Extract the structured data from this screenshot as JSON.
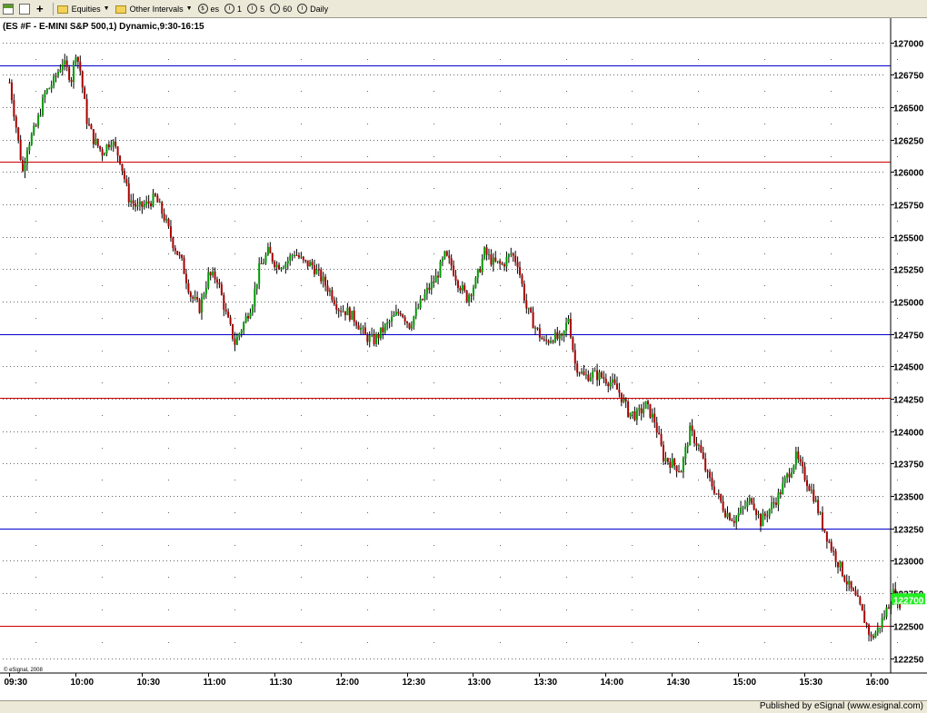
{
  "toolbar": {
    "equities_label": "Equities",
    "other_intervals_label": "Other Intervals",
    "symbol_label": "es",
    "interval_1": "1",
    "interval_5": "5",
    "interval_60": "60",
    "interval_daily": "Daily"
  },
  "footer": {
    "published_label": "Published by eSignal (www.esignal.com)"
  },
  "chart_data": {
    "type": "candlestick",
    "title": "(ES #F - E-MINI S&P 500,1) Dynamic,9:30-16:15",
    "watermark": "© eSignal, 2008",
    "price_label": "122700",
    "price_label_value": 1227.0,
    "y_ticks": [
      {
        "value": 1270.0,
        "label": "127000"
      },
      {
        "value": 1267.5,
        "label": "126750"
      },
      {
        "value": 1265.0,
        "label": "126500"
      },
      {
        "value": 1262.5,
        "label": "126250"
      },
      {
        "value": 1260.0,
        "label": "126000"
      },
      {
        "value": 1257.5,
        "label": "125750"
      },
      {
        "value": 1255.0,
        "label": "125500"
      },
      {
        "value": 1252.5,
        "label": "125250"
      },
      {
        "value": 1250.0,
        "label": "125000"
      },
      {
        "value": 1247.5,
        "label": "124750"
      },
      {
        "value": 1245.0,
        "label": "124500"
      },
      {
        "value": 1242.5,
        "label": "124250"
      },
      {
        "value": 1240.0,
        "label": "124000"
      },
      {
        "value": 1237.5,
        "label": "123750"
      },
      {
        "value": 1235.0,
        "label": "123500"
      },
      {
        "value": 1232.5,
        "label": "123250"
      },
      {
        "value": 1230.0,
        "label": "123000"
      },
      {
        "value": 1227.5,
        "label": "122750"
      },
      {
        "value": 1225.0,
        "label": "122500"
      },
      {
        "value": 1222.5,
        "label": "122250"
      }
    ],
    "x_ticks": [
      {
        "minute": 0,
        "label": "09:30"
      },
      {
        "minute": 30,
        "label": "10:00"
      },
      {
        "minute": 60,
        "label": "10:30"
      },
      {
        "minute": 90,
        "label": "11:00"
      },
      {
        "minute": 120,
        "label": "11:30"
      },
      {
        "minute": 150,
        "label": "12:00"
      },
      {
        "minute": 180,
        "label": "12:30"
      },
      {
        "minute": 210,
        "label": "13:00"
      },
      {
        "minute": 240,
        "label": "13:30"
      },
      {
        "minute": 270,
        "label": "14:00"
      },
      {
        "minute": 300,
        "label": "14:30"
      },
      {
        "minute": 330,
        "label": "15:00"
      },
      {
        "minute": 360,
        "label": "15:30"
      },
      {
        "minute": 390,
        "label": "16:00"
      }
    ],
    "xlim": [
      0,
      405
    ],
    "ylim": [
      1221.5,
      1271.0
    ],
    "horizontal_lines": [
      {
        "value": 1268.2,
        "color": "#0000cc"
      },
      {
        "value": 1260.8,
        "color": "#cc0000"
      },
      {
        "value": 1247.5,
        "color": "#0000cc"
      },
      {
        "value": 1242.6,
        "color": "#cc0000"
      },
      {
        "value": 1232.5,
        "color": "#0000cc"
      },
      {
        "value": 1225.0,
        "color": "#cc0000"
      }
    ],
    "colors": {
      "up": "#009900",
      "down": "#aa0000",
      "wick": "#000000",
      "grid": "#555555",
      "price_label_bg": "#22ee22"
    },
    "price_path": [
      [
        0,
        1266.9
      ],
      [
        3,
        1263.5
      ],
      [
        6,
        1260.0
      ],
      [
        8,
        1262.0
      ],
      [
        12,
        1263.5
      ],
      [
        16,
        1266.0
      ],
      [
        20,
        1267.0
      ],
      [
        24,
        1268.5
      ],
      [
        28,
        1267.2
      ],
      [
        30,
        1269.3
      ],
      [
        32,
        1267.8
      ],
      [
        35,
        1264.0
      ],
      [
        38,
        1262.5
      ],
      [
        42,
        1261.5
      ],
      [
        46,
        1262.5
      ],
      [
        50,
        1261.0
      ],
      [
        54,
        1258.0
      ],
      [
        58,
        1257.2
      ],
      [
        62,
        1257.5
      ],
      [
        66,
        1258.0
      ],
      [
        70,
        1256.5
      ],
      [
        74,
        1254.5
      ],
      [
        78,
        1253.0
      ],
      [
        82,
        1250.5
      ],
      [
        86,
        1249.5
      ],
      [
        90,
        1252.0
      ],
      [
        94,
        1251.8
      ],
      [
        98,
        1249.0
      ],
      [
        102,
        1246.8
      ],
      [
        106,
        1248.3
      ],
      [
        110,
        1250.0
      ],
      [
        113,
        1252.5
      ],
      [
        117,
        1253.8
      ],
      [
        121,
        1252.8
      ],
      [
        125,
        1253.0
      ],
      [
        129,
        1253.8
      ],
      [
        133,
        1253.0
      ],
      [
        137,
        1252.8
      ],
      [
        141,
        1251.8
      ],
      [
        145,
        1250.8
      ],
      [
        149,
        1249.5
      ],
      [
        153,
        1249.2
      ],
      [
        157,
        1248.5
      ],
      [
        161,
        1247.3
      ],
      [
        165,
        1247.0
      ],
      [
        169,
        1247.8
      ],
      [
        173,
        1248.6
      ],
      [
        177,
        1249.3
      ],
      [
        181,
        1248.2
      ],
      [
        185,
        1249.5
      ],
      [
        189,
        1250.8
      ],
      [
        193,
        1251.8
      ],
      [
        197,
        1253.5
      ],
      [
        200,
        1252.8
      ],
      [
        203,
        1251.5
      ],
      [
        207,
        1250.3
      ],
      [
        211,
        1251.5
      ],
      [
        215,
        1253.8
      ],
      [
        219,
        1253.0
      ],
      [
        223,
        1252.8
      ],
      [
        227,
        1253.7
      ],
      [
        230,
        1253.0
      ],
      [
        234,
        1249.5
      ],
      [
        238,
        1248.0
      ],
      [
        242,
        1246.8
      ],
      [
        246,
        1247.3
      ],
      [
        250,
        1247.0
      ],
      [
        253,
        1248.8
      ],
      [
        256,
        1245.2
      ],
      [
        260,
        1244.2
      ],
      [
        264,
        1244.4
      ],
      [
        268,
        1244.2
      ],
      [
        272,
        1243.8
      ],
      [
        276,
        1243.0
      ],
      [
        280,
        1241.5
      ],
      [
        284,
        1241.2
      ],
      [
        288,
        1242.0
      ],
      [
        292,
        1240.8
      ],
      [
        296,
        1238.0
      ],
      [
        300,
        1237.5
      ],
      [
        304,
        1237.0
      ],
      [
        308,
        1240.0
      ],
      [
        312,
        1238.8
      ],
      [
        316,
        1236.5
      ],
      [
        320,
        1235.2
      ],
      [
        324,
        1233.8
      ],
      [
        328,
        1233.2
      ],
      [
        332,
        1234.0
      ],
      [
        336,
        1234.8
      ],
      [
        340,
        1233.0
      ],
      [
        344,
        1234.0
      ],
      [
        348,
        1235.0
      ],
      [
        352,
        1236.5
      ],
      [
        356,
        1238.0
      ],
      [
        360,
        1236.5
      ],
      [
        364,
        1235.0
      ],
      [
        368,
        1232.8
      ],
      [
        372,
        1231.0
      ],
      [
        376,
        1229.5
      ],
      [
        380,
        1228.0
      ],
      [
        384,
        1226.8
      ],
      [
        388,
        1225.0
      ],
      [
        390,
        1224.0
      ],
      [
        393,
        1224.7
      ],
      [
        396,
        1225.8
      ],
      [
        400,
        1227.5
      ],
      [
        403,
        1226.8
      ]
    ]
  }
}
